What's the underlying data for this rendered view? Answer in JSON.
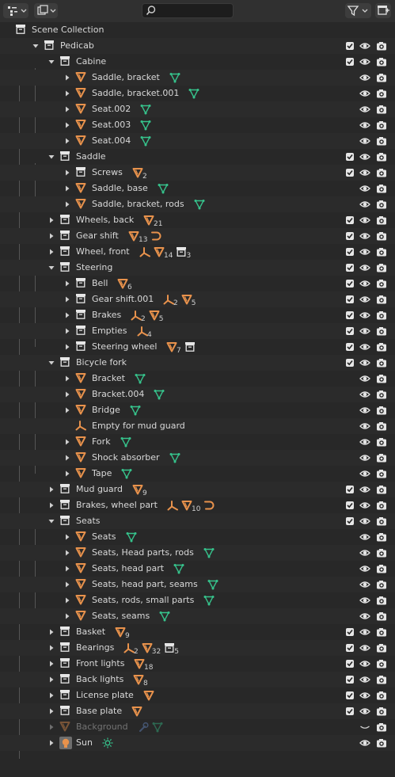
{
  "header": {
    "display_mode_icon": "outliner-icon",
    "filter_icon": "funnel-icon",
    "search": {
      "value": "",
      "placeholder": "",
      "icon": "search-icon"
    },
    "new_collection_icon": "new-collection-icon"
  },
  "colors": {
    "mesh": "#e8924c",
    "data_green": "#36c38c",
    "empty": "#e8924c",
    "camera": "#e6e6e6",
    "wrench": "#6a8fd0"
  },
  "tree": {
    "rows": [
      {
        "depth": 0,
        "expander": "none",
        "icon": "collection-icon",
        "label": "Scene Collection",
        "chk": false,
        "eye": false,
        "cam": false,
        "extras": []
      },
      {
        "depth": 1,
        "expander": "open",
        "icon": "collection-icon",
        "label": "Pedicab",
        "chk": true,
        "eye": true,
        "cam": true,
        "extras": []
      },
      {
        "depth": 2,
        "expander": "open",
        "icon": "collection-icon",
        "label": "Cabine",
        "chk": true,
        "eye": true,
        "cam": true,
        "extras": []
      },
      {
        "depth": 3,
        "expander": "closed",
        "icon": "mesh-icon",
        "label": "Saddle, bracket",
        "chk": false,
        "eye": true,
        "cam": true,
        "extras": [
          {
            "icon": "mesh-data-icon",
            "count": ""
          }
        ]
      },
      {
        "depth": 3,
        "expander": "closed",
        "icon": "mesh-icon",
        "label": "Saddle, bracket.001",
        "chk": false,
        "eye": true,
        "cam": true,
        "extras": [
          {
            "icon": "mesh-data-icon",
            "count": ""
          }
        ]
      },
      {
        "depth": 3,
        "expander": "closed",
        "icon": "mesh-icon",
        "label": "Seat.002",
        "chk": false,
        "eye": true,
        "cam": true,
        "extras": [
          {
            "icon": "mesh-data-icon",
            "count": ""
          }
        ]
      },
      {
        "depth": 3,
        "expander": "closed",
        "icon": "mesh-icon",
        "label": "Seat.003",
        "chk": false,
        "eye": true,
        "cam": true,
        "extras": [
          {
            "icon": "mesh-data-icon",
            "count": ""
          }
        ]
      },
      {
        "depth": 3,
        "expander": "closed",
        "icon": "mesh-icon",
        "label": "Seat.004",
        "chk": false,
        "eye": true,
        "cam": true,
        "extras": [
          {
            "icon": "mesh-data-icon",
            "count": ""
          }
        ]
      },
      {
        "depth": 2,
        "expander": "open",
        "icon": "collection-icon",
        "label": "Saddle",
        "chk": true,
        "eye": true,
        "cam": true,
        "extras": []
      },
      {
        "depth": 3,
        "expander": "closed",
        "icon": "collection-icon",
        "label": "Screws",
        "chk": true,
        "eye": true,
        "cam": true,
        "extras": [
          {
            "icon": "mesh-icon",
            "count": "2"
          }
        ]
      },
      {
        "depth": 3,
        "expander": "closed",
        "icon": "mesh-icon",
        "label": "Saddle, base",
        "chk": false,
        "eye": true,
        "cam": true,
        "extras": [
          {
            "icon": "mesh-data-icon",
            "count": ""
          }
        ]
      },
      {
        "depth": 3,
        "expander": "closed",
        "icon": "mesh-icon",
        "label": "Saddle, bracket, rods",
        "chk": false,
        "eye": true,
        "cam": true,
        "extras": [
          {
            "icon": "mesh-data-icon",
            "count": ""
          }
        ]
      },
      {
        "depth": 2,
        "expander": "closed",
        "icon": "collection-icon",
        "label": "Wheels, back",
        "chk": true,
        "eye": true,
        "cam": true,
        "extras": [
          {
            "icon": "mesh-icon",
            "count": "21"
          }
        ]
      },
      {
        "depth": 2,
        "expander": "closed",
        "icon": "collection-icon",
        "label": "Gear shift",
        "chk": true,
        "eye": true,
        "cam": true,
        "extras": [
          {
            "icon": "mesh-icon",
            "count": "13"
          },
          {
            "icon": "curve-icon",
            "count": ""
          }
        ]
      },
      {
        "depth": 2,
        "expander": "closed",
        "icon": "collection-icon",
        "label": "Wheel, front",
        "chk": true,
        "eye": true,
        "cam": true,
        "extras": [
          {
            "icon": "empty-icon",
            "count": ""
          },
          {
            "icon": "mesh-icon",
            "count": "14"
          },
          {
            "icon": "collection-icon",
            "count": "3"
          }
        ]
      },
      {
        "depth": 2,
        "expander": "open",
        "icon": "collection-icon",
        "label": "Steering",
        "chk": true,
        "eye": true,
        "cam": true,
        "extras": []
      },
      {
        "depth": 3,
        "expander": "closed",
        "icon": "collection-icon",
        "label": "Bell",
        "chk": true,
        "eye": true,
        "cam": true,
        "extras": [
          {
            "icon": "mesh-icon",
            "count": "6"
          }
        ]
      },
      {
        "depth": 3,
        "expander": "closed",
        "icon": "collection-icon",
        "label": "Gear shift.001",
        "chk": true,
        "eye": true,
        "cam": true,
        "extras": [
          {
            "icon": "empty-icon",
            "count": "2"
          },
          {
            "icon": "mesh-icon",
            "count": "5"
          }
        ]
      },
      {
        "depth": 3,
        "expander": "closed",
        "icon": "collection-icon",
        "label": "Brakes",
        "chk": true,
        "eye": true,
        "cam": true,
        "extras": [
          {
            "icon": "empty-icon",
            "count": "2"
          },
          {
            "icon": "mesh-icon",
            "count": "5"
          }
        ]
      },
      {
        "depth": 3,
        "expander": "closed",
        "icon": "collection-icon",
        "label": "Empties",
        "chk": true,
        "eye": true,
        "cam": true,
        "extras": [
          {
            "icon": "empty-icon",
            "count": "4"
          }
        ]
      },
      {
        "depth": 3,
        "expander": "closed",
        "icon": "collection-icon",
        "label": "Steering wheel",
        "chk": true,
        "eye": true,
        "cam": true,
        "extras": [
          {
            "icon": "mesh-icon",
            "count": "7"
          },
          {
            "icon": "collection-icon",
            "count": ""
          }
        ]
      },
      {
        "depth": 2,
        "expander": "open",
        "icon": "collection-icon",
        "label": "Bicycle fork",
        "chk": true,
        "eye": true,
        "cam": true,
        "extras": []
      },
      {
        "depth": 3,
        "expander": "closed",
        "icon": "mesh-icon",
        "label": "Bracket",
        "chk": false,
        "eye": true,
        "cam": true,
        "extras": [
          {
            "icon": "mesh-data-icon",
            "count": ""
          }
        ]
      },
      {
        "depth": 3,
        "expander": "closed",
        "icon": "mesh-icon",
        "label": "Bracket.004",
        "chk": false,
        "eye": true,
        "cam": true,
        "extras": [
          {
            "icon": "mesh-data-icon",
            "count": ""
          }
        ]
      },
      {
        "depth": 3,
        "expander": "closed",
        "icon": "mesh-icon",
        "label": "Bridge",
        "chk": false,
        "eye": true,
        "cam": true,
        "extras": [
          {
            "icon": "mesh-data-icon",
            "count": ""
          }
        ]
      },
      {
        "depth": 3,
        "expander": "none",
        "icon": "empty-icon",
        "label": "Empty for mud guard",
        "chk": false,
        "eye": true,
        "cam": true,
        "extras": []
      },
      {
        "depth": 3,
        "expander": "closed",
        "icon": "mesh-icon",
        "label": "Fork",
        "chk": false,
        "eye": true,
        "cam": true,
        "extras": [
          {
            "icon": "mesh-data-icon",
            "count": ""
          }
        ]
      },
      {
        "depth": 3,
        "expander": "closed",
        "icon": "mesh-icon",
        "label": "Shock absorber",
        "chk": false,
        "eye": true,
        "cam": true,
        "extras": [
          {
            "icon": "mesh-data-icon",
            "count": ""
          }
        ]
      },
      {
        "depth": 3,
        "expander": "closed",
        "icon": "mesh-icon",
        "label": "Tape",
        "chk": false,
        "eye": true,
        "cam": true,
        "extras": [
          {
            "icon": "mesh-data-icon",
            "count": ""
          }
        ]
      },
      {
        "depth": 2,
        "expander": "closed",
        "icon": "collection-icon",
        "label": "Mud guard",
        "chk": true,
        "eye": true,
        "cam": true,
        "extras": [
          {
            "icon": "mesh-icon",
            "count": "9"
          }
        ]
      },
      {
        "depth": 2,
        "expander": "closed",
        "icon": "collection-icon",
        "label": "Brakes, wheel part",
        "chk": true,
        "eye": true,
        "cam": true,
        "extras": [
          {
            "icon": "empty-icon",
            "count": ""
          },
          {
            "icon": "mesh-icon",
            "count": "10"
          },
          {
            "icon": "curve-icon",
            "count": ""
          }
        ]
      },
      {
        "depth": 2,
        "expander": "open",
        "icon": "collection-icon",
        "label": "Seats",
        "chk": true,
        "eye": true,
        "cam": true,
        "extras": []
      },
      {
        "depth": 3,
        "expander": "closed",
        "icon": "mesh-icon",
        "label": "Seats",
        "chk": false,
        "eye": true,
        "cam": true,
        "extras": [
          {
            "icon": "mesh-data-icon",
            "count": ""
          }
        ]
      },
      {
        "depth": 3,
        "expander": "closed",
        "icon": "mesh-icon",
        "label": "Seats, Head parts, rods",
        "chk": false,
        "eye": true,
        "cam": true,
        "extras": [
          {
            "icon": "mesh-data-icon",
            "count": ""
          }
        ]
      },
      {
        "depth": 3,
        "expander": "closed",
        "icon": "mesh-icon",
        "label": "Seats, head part",
        "chk": false,
        "eye": true,
        "cam": true,
        "extras": [
          {
            "icon": "mesh-data-icon",
            "count": ""
          }
        ]
      },
      {
        "depth": 3,
        "expander": "closed",
        "icon": "mesh-icon",
        "label": "Seats, head part, seams",
        "chk": false,
        "eye": true,
        "cam": true,
        "extras": [
          {
            "icon": "mesh-data-icon",
            "count": ""
          }
        ]
      },
      {
        "depth": 3,
        "expander": "closed",
        "icon": "mesh-icon",
        "label": "Seats, rods, small parts",
        "chk": false,
        "eye": true,
        "cam": true,
        "extras": [
          {
            "icon": "mesh-data-icon",
            "count": ""
          }
        ]
      },
      {
        "depth": 3,
        "expander": "closed",
        "icon": "mesh-icon",
        "label": "Seats, seams",
        "chk": false,
        "eye": true,
        "cam": true,
        "extras": [
          {
            "icon": "mesh-data-icon",
            "count": ""
          }
        ]
      },
      {
        "depth": 2,
        "expander": "closed",
        "icon": "collection-icon",
        "label": "Basket",
        "chk": true,
        "eye": true,
        "cam": true,
        "extras": [
          {
            "icon": "mesh-icon",
            "count": "9"
          }
        ]
      },
      {
        "depth": 2,
        "expander": "closed",
        "icon": "collection-icon",
        "label": "Bearings",
        "chk": true,
        "eye": true,
        "cam": true,
        "extras": [
          {
            "icon": "empty-icon",
            "count": "2"
          },
          {
            "icon": "mesh-icon",
            "count": "32"
          },
          {
            "icon": "collection-icon",
            "count": "5"
          }
        ]
      },
      {
        "depth": 2,
        "expander": "closed",
        "icon": "collection-icon",
        "label": "Front lights",
        "chk": true,
        "eye": true,
        "cam": true,
        "extras": [
          {
            "icon": "mesh-icon",
            "count": "18"
          }
        ]
      },
      {
        "depth": 2,
        "expander": "closed",
        "icon": "collection-icon",
        "label": "Back lights",
        "chk": true,
        "eye": true,
        "cam": true,
        "extras": [
          {
            "icon": "mesh-icon",
            "count": "8"
          }
        ]
      },
      {
        "depth": 2,
        "expander": "closed",
        "icon": "collection-icon",
        "label": "License plate",
        "chk": true,
        "eye": true,
        "cam": true,
        "extras": [
          {
            "icon": "mesh-icon",
            "count": ""
          }
        ]
      },
      {
        "depth": 2,
        "expander": "closed",
        "icon": "collection-icon",
        "label": "Base plate",
        "chk": true,
        "eye": true,
        "cam": true,
        "extras": [
          {
            "icon": "mesh-icon",
            "count": ""
          }
        ]
      },
      {
        "depth": 2,
        "expander": "closed",
        "icon": "mesh-icon",
        "label": "Background",
        "chk": false,
        "eye": false,
        "hidden": true,
        "cam": true,
        "dimmed": true,
        "extras": [
          {
            "icon": "wrench-icon",
            "count": ""
          },
          {
            "icon": "mesh-data-icon",
            "count": ""
          }
        ]
      },
      {
        "depth": 2,
        "expander": "closed",
        "icon": "light-icon",
        "label": "Sun",
        "chk": false,
        "eye": true,
        "cam": true,
        "extras": [
          {
            "icon": "sun-icon",
            "count": ""
          }
        ]
      }
    ]
  }
}
